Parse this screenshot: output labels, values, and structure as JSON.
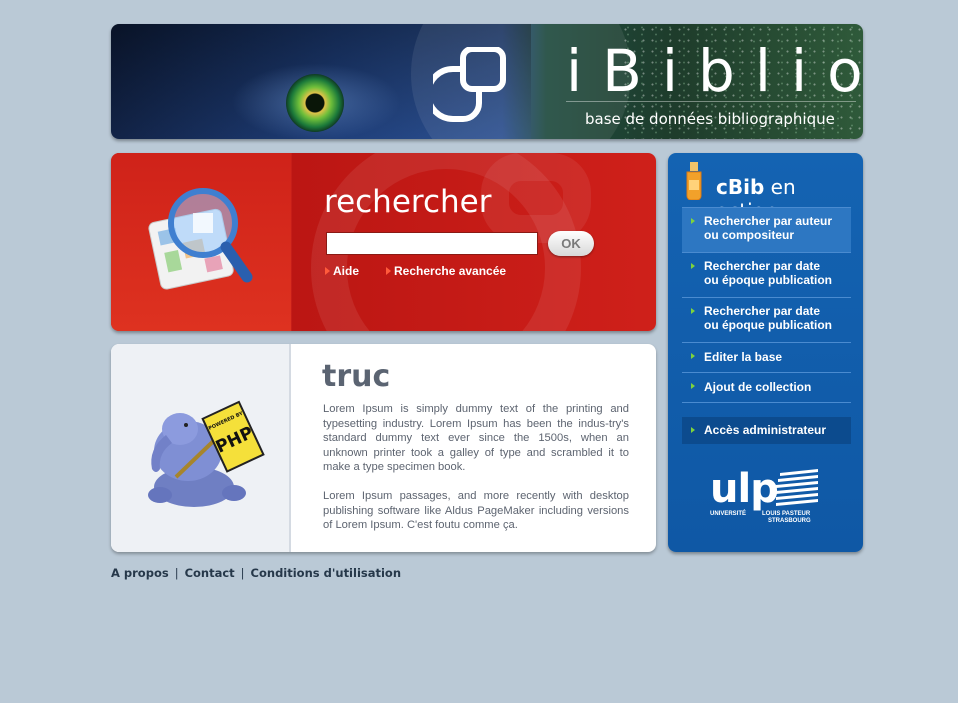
{
  "header": {
    "title": "iBiblio",
    "subtitle": "base de données bibliographique"
  },
  "search": {
    "title": "rechercher",
    "input_value": "",
    "ok_label": "OK",
    "help_link": "Aide",
    "advanced_link": "Recherche avancée"
  },
  "content": {
    "title": "truc",
    "paragraphs": [
      "Lorem Ipsum is simply dummy text of the printing and typesetting industry. Lorem Ipsum has been the indus-try's standard dummy text ever since the 1500s, when an unknown printer took a galley of type and scrambled it to make a type specimen book.",
      "Lorem Ipsum passages, and more recently with desktop publishing software like Aldus PageMaker including versions of Lorem Ipsum. C'est foutu comme ça."
    ],
    "mascot_text": "PHP",
    "mascot_badge": "POWERED BY"
  },
  "sidebar": {
    "title_bold": "cBib",
    "title_rest": " en action",
    "items": [
      {
        "line1": "Rechercher par auteur",
        "line2": "ou compositeur"
      },
      {
        "line1": "Rechercher par date",
        "line2": "ou époque publication"
      },
      {
        "line1": "Rechercher par date",
        "line2": "ou époque publication"
      },
      {
        "line1": "Editer la base"
      },
      {
        "line1": "Ajout de collection"
      }
    ],
    "admin_label": "Accès administrateur",
    "logo": {
      "main": "ulp",
      "line_left1": "UNIVERSITÉ",
      "line_right1": "LOUIS PASTEUR",
      "line_right2": "STRASBOURG"
    }
  },
  "footer": {
    "links": [
      "A propos",
      "Contact",
      "Conditions d'utilisation"
    ],
    "separator": "|"
  },
  "colors": {
    "page_bg": "#bac9d6",
    "search_red": "#cf201a",
    "sidebar_blue": "#1463b2",
    "menu_arrow_green": "#7ed33c",
    "text_grey": "#5d6470"
  }
}
